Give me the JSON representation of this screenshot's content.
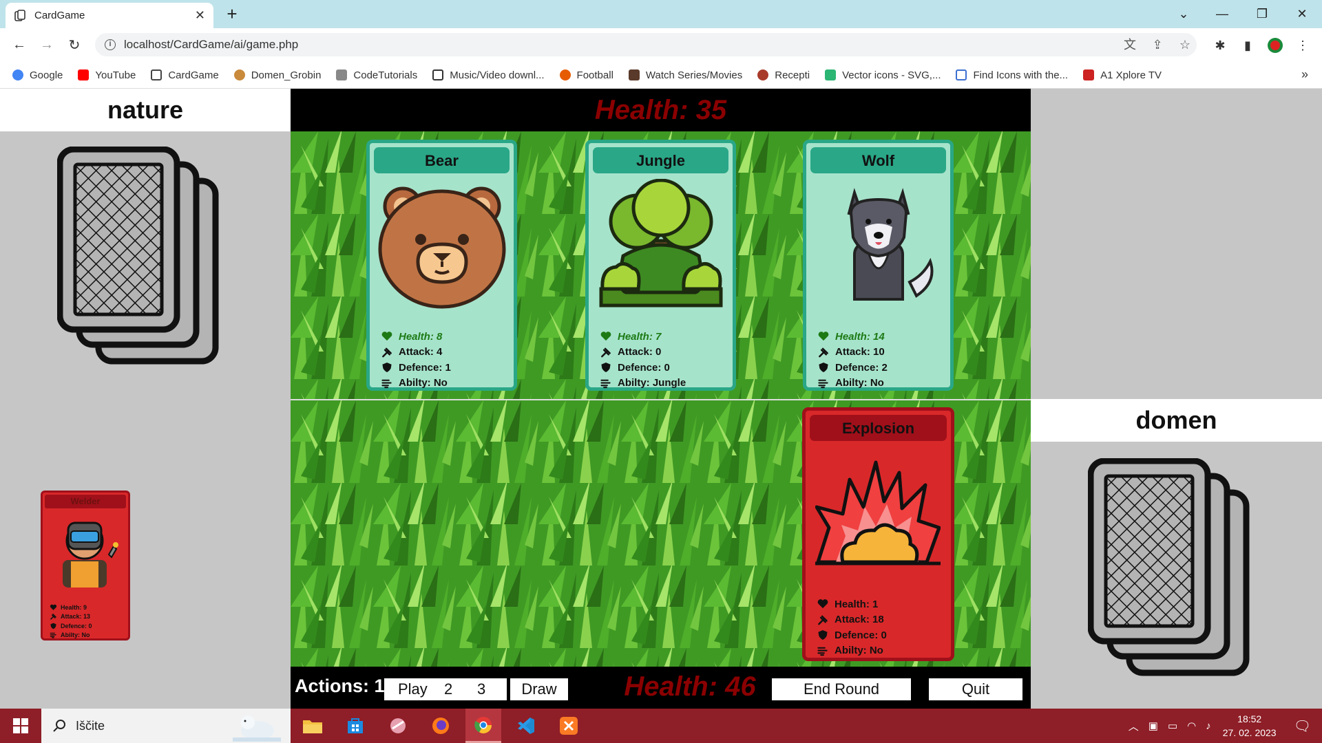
{
  "browser": {
    "tab_title": "CardGame",
    "url": "localhost/CardGame/ai/game.php",
    "bookmarks": [
      {
        "label": "Google",
        "color": "#4285f4"
      },
      {
        "label": "YouTube",
        "color": "#ff0000"
      },
      {
        "label": "CardGame",
        "color": "#444444"
      },
      {
        "label": "Domen_Grobin",
        "color": "#c98a3c"
      },
      {
        "label": "CodeTutorials",
        "color": "#666666"
      },
      {
        "label": "Music/Video downl...",
        "color": "#333333"
      },
      {
        "label": "Football",
        "color": "#e65c00"
      },
      {
        "label": "Watch Series/Movies",
        "color": "#5a3a2a"
      },
      {
        "label": "Recepti",
        "color": "#a83a2a"
      },
      {
        "label": "Vector icons - SVG,...",
        "color": "#2bb673"
      },
      {
        "label": "Find Icons with the...",
        "color": "#3d6fd1"
      },
      {
        "label": "A1 Xplore TV",
        "color": "#cc2222"
      }
    ]
  },
  "game": {
    "opponent": {
      "name": "nature",
      "health_text": "Health: 35"
    },
    "player": {
      "name": "domen",
      "health_text": "Health: 46"
    },
    "enemy_cards": [
      {
        "name": "Bear",
        "art": "bear-face",
        "health": "Health: 8",
        "attack": "Attack: 4",
        "defence": "Defence: 1",
        "ability": "Abilty: No"
      },
      {
        "name": "Jungle",
        "art": "jungle-trees",
        "health": "Health: 7",
        "attack": "Attack: 0",
        "defence": "Defence: 0",
        "ability": "Abilty: Jungle"
      },
      {
        "name": "Wolf",
        "art": "wolf",
        "health": "Health: 14",
        "attack": "Attack: 10",
        "defence": "Defence: 2",
        "ability": "Abilty: No"
      }
    ],
    "hand_card": {
      "name": "Welder",
      "art": "welder",
      "health": "Health: 9",
      "attack": "Attack: 13",
      "defence": "Defence: 0",
      "ability": "Abilty: No"
    },
    "player_card": {
      "name": "Explosion",
      "art": "explosion",
      "health": "Health: 1",
      "attack": "Attack: 18",
      "defence": "Defence: 0",
      "ability": "Abilty: No"
    },
    "controls": {
      "actions": "Actions: 1",
      "play": "Play",
      "play_2": "2",
      "play_3": "3",
      "draw": "Draw",
      "end_round": "End Round",
      "quit": "Quit"
    }
  },
  "taskbar": {
    "search_placeholder": "Iščite",
    "time": "18:52",
    "date": "27. 02. 2023"
  }
}
